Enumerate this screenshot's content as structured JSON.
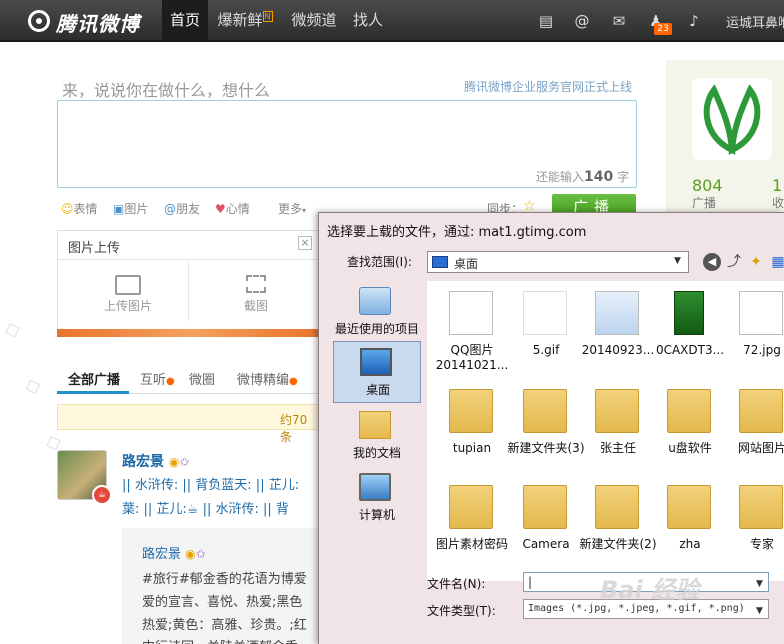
{
  "nav": {
    "logo_text": "腾讯微博",
    "tabs": [
      {
        "label": "首页"
      },
      {
        "label": "爆新鲜",
        "badge": "N"
      },
      {
        "label": "微频道"
      },
      {
        "label": "找人"
      }
    ],
    "icons": [
      "feed-icon",
      "mention-icon",
      "mail-icon",
      "user-icon",
      "sound-icon"
    ],
    "notify_count": "23",
    "username": "运城耳鼻喉"
  },
  "composer": {
    "prompt": "来，说说你在做什么，想什么",
    "biz_link": "腾讯微博企业服务官网正式上线",
    "remain_prefix": "还能输入",
    "remain_count": "140",
    "remain_suffix": "字",
    "tools": [
      {
        "icon": "smile-icon",
        "label": "表情"
      },
      {
        "icon": "image-icon",
        "label": "图片"
      },
      {
        "icon": "at-icon",
        "label": "朋友"
      },
      {
        "icon": "heart-icon",
        "label": "心情"
      },
      {
        "icon": "more-icon",
        "label": "更多"
      }
    ],
    "sync_label": "同步：",
    "post_label": "广播"
  },
  "upload_panel": {
    "title": "图片上传",
    "close": "×",
    "upload_photo": "上传图片",
    "screenshot": "截图"
  },
  "feed_tabs": [
    "全部广播",
    "互听",
    "微圈",
    "微博精编"
  ],
  "notice_text": "约70条",
  "post": {
    "author": "路宏景",
    "line1": "|| 水浒传: || 背负蓝天: || 芷儿:",
    "line2": "葉: || 芷儿:☕ || 水浒传: || 背",
    "repost": {
      "author": "路宏景",
      "line1": "#旅行#郁金香的花语为博爱",
      "line2": "爱的宣言、喜悦、热爱;黑色",
      "line3": "热爱;黄色：高雅、珍贵。;红",
      "line4": "中行诗回，关陆关酒郁金香"
    }
  },
  "right_panel": {
    "stat1_value": "804",
    "stat1_label": "广播",
    "stat2_value": "1",
    "stat2_label": "收"
  },
  "dialog": {
    "title": "选择要上载的文件，通过: mat1.gtimg.com",
    "look_in_label": "查找范围(I):",
    "look_in_value": "桌面",
    "places": [
      {
        "label": "最近使用的项目",
        "icon": "recent-items-icon"
      },
      {
        "label": "桌面",
        "icon": "desktop-icon"
      },
      {
        "label": "我的文档",
        "icon": "my-documents-icon"
      },
      {
        "label": "计算机",
        "icon": "computer-icon"
      }
    ],
    "files": [
      {
        "label": "QQ图片20141021...",
        "kind": "image"
      },
      {
        "label": "5.gif",
        "kind": "image"
      },
      {
        "label": "20140923...",
        "kind": "image"
      },
      {
        "label": "0CAXDT3...",
        "kind": "image"
      },
      {
        "label": "72.jpg",
        "kind": "image"
      },
      {
        "label": "tupian",
        "kind": "folder"
      },
      {
        "label": "新建文件夹(3)",
        "kind": "folder"
      },
      {
        "label": "张主任",
        "kind": "folder"
      },
      {
        "label": "u盘软件",
        "kind": "folder"
      },
      {
        "label": "网站图片",
        "kind": "folder"
      },
      {
        "label": "图片素材密码",
        "kind": "folder"
      },
      {
        "label": "Camera",
        "kind": "folder"
      },
      {
        "label": "新建文件夹(2)",
        "kind": "folder"
      },
      {
        "label": "zha",
        "kind": "folder"
      },
      {
        "label": "专家",
        "kind": "folder"
      }
    ],
    "filename_label": "文件名(N):",
    "filename_value": "",
    "filetype_label": "文件类型(T):",
    "filetype_value": "Images (*.jpg, *.jpeg, *.gif, *.png)"
  },
  "watermark": "Bai 经验"
}
